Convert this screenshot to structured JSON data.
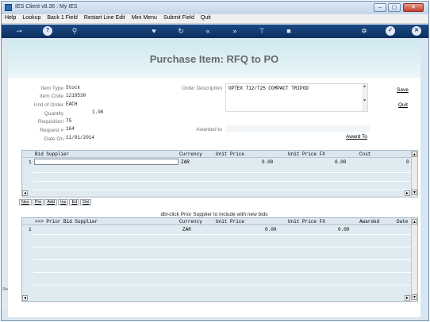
{
  "window": {
    "title": "IES Client v8.36 : My IES",
    "controls": [
      "–",
      "▢",
      "✕"
    ]
  },
  "menu": [
    "Help",
    "Lookup",
    "Back 1 Field",
    "Restart Line Edit",
    "Mini Menu",
    "Submit Field",
    "Quit"
  ],
  "toolbar": {
    "icons": [
      "key-icon",
      "help-icon",
      "search-icon",
      "heart-icon",
      "refresh-icon",
      "rewind-icon",
      "forward-icon",
      "pin-icon",
      "stop-icon",
      "settings-icon",
      "check-icon",
      "close-icon"
    ]
  },
  "page": {
    "title": "Purchase Item: RFQ to PO"
  },
  "form": {
    "item_type_label": "Item Type",
    "item_type": "Stock",
    "item_code_label": "Item Code",
    "item_code": "1219530",
    "unit_label": "Unit of Order",
    "unit": "EACH",
    "quantity_label": "Quantity",
    "quantity": "1.00",
    "requisition_label": "Requisition",
    "requisition": "75",
    "request_label": "Request #",
    "request": "164",
    "date_label": "Date On",
    "date": "11/01/2014",
    "order_desc_label": "Order Description",
    "order_desc": "OPTEX T12/T25 COMPACT TRIPOD",
    "awarded_label": "Awarded to",
    "awarded": ""
  },
  "links": {
    "save": "Save",
    "quit": "Quit",
    "award_to": "Award To"
  },
  "bid_grid": {
    "columns": [
      "Bid Supplier",
      "Currency",
      "Unit Price",
      "Unit Price FX",
      "Cost"
    ],
    "rows": [
      {
        "num": "1",
        "supplier": "",
        "currency": "ZAR",
        "unit_price": "0.00",
        "unit_price_fx": "0.00",
        "cost": "0"
      }
    ]
  },
  "actions": [
    "Nex",
    "Pre",
    "Add",
    "Ins",
    "Ed",
    "Del"
  ],
  "hint": "dbl-click Prior Supplier to include with new bids",
  "prior_grid": {
    "columns": [
      ">>> Prior Bid Supplier",
      "Currency",
      "Unit Price",
      "Unit Price FX",
      "Awarded",
      "Date"
    ],
    "rows": [
      {
        "num": "1",
        "supplier": "",
        "currency": "ZAR",
        "unit_price": "0.00",
        "unit_price_fx": "0.00",
        "awarded": "",
        "date": ""
      }
    ]
  },
  "side_label": "Sea"
}
